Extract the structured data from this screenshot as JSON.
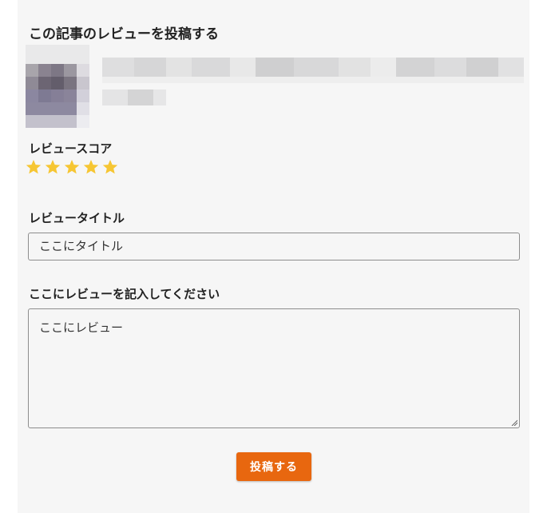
{
  "form": {
    "heading": "この記事のレビューを投稿する",
    "score_label": "レビュースコア",
    "rating": 5,
    "rating_max": 5,
    "star_color": "#f6c633",
    "title_label": "レビュータイトル",
    "title_value": "ここにタイトル",
    "body_label": "ここにレビューを記入してください",
    "body_value": "ここにレビュー",
    "submit_label": "投稿する",
    "accent_color": "#e8670f"
  }
}
